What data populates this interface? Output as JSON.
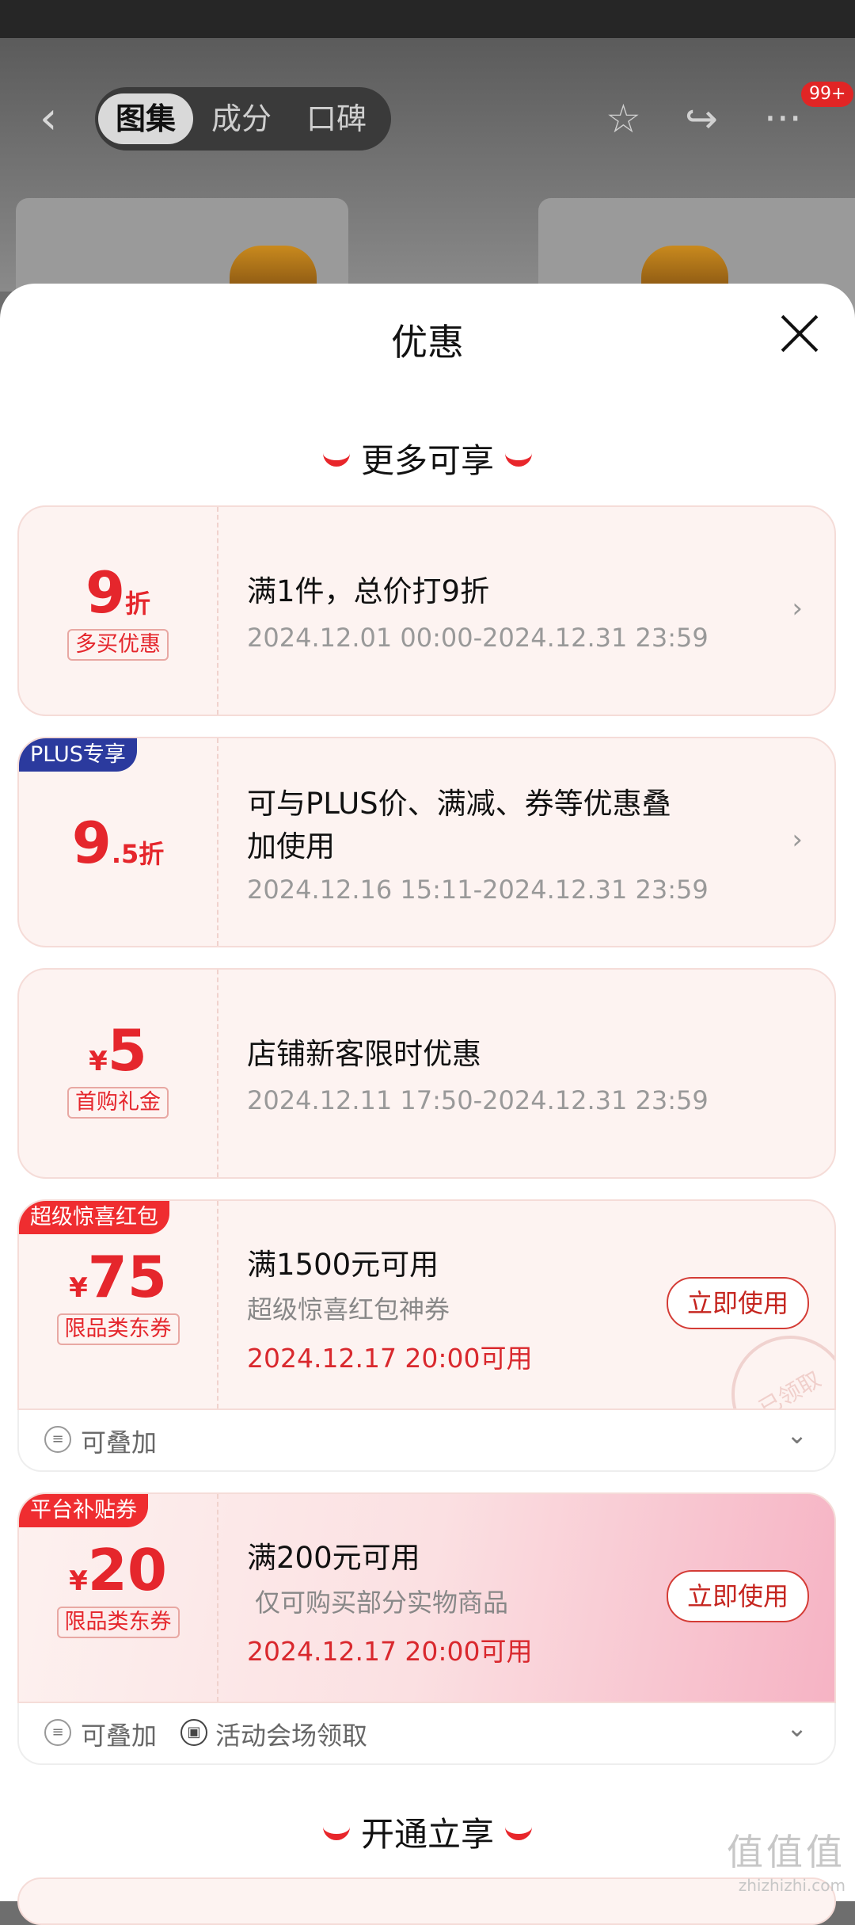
{
  "nav": {
    "back_icon": "‹",
    "tabs": [
      "图集",
      "成分",
      "口碑"
    ],
    "star_icon": "☆",
    "share_icon": "↪",
    "more_icon": "···",
    "badge": "99+"
  },
  "sheet": {
    "title": "优惠",
    "section1": "更多可享",
    "section2": "开通立享"
  },
  "offers": [
    {
      "num": "9",
      "unit": "折",
      "tag": "多买优惠",
      "title": "满1件，总价打9折",
      "date": "2024.12.01 00:00-2024.12.31 23:59"
    },
    {
      "corner": "PLUS专享",
      "num": "9",
      "unit": ".5折",
      "title_line1": "可与PLUS价、满减、券等优惠叠",
      "title_line2": "加使用",
      "date": "2024.12.16 15:11-2024.12.31 23:59"
    },
    {
      "yen": "¥",
      "num": "5",
      "tag": "首购礼金",
      "title": "店铺新客限时优惠",
      "date": "2024.12.11 17:50-2024.12.31 23:59"
    },
    {
      "corner": "超级惊喜红包",
      "yen": "¥",
      "num": "75",
      "tag": "限品类东券",
      "title": "满1500元可用",
      "sub": "超级惊喜红包神券",
      "date": "2024.12.17 20:00可用",
      "button": "立即使用",
      "stamp": "已领取",
      "footer": [
        "可叠加"
      ]
    },
    {
      "corner": "平台补贴券",
      "yen": "¥",
      "num": "20",
      "tag": "限品类东券",
      "title": "满200元可用",
      "sub": "仅可购买部分实物商品",
      "date": "2024.12.17 20:00可用",
      "button": "立即使用",
      "footer": [
        "可叠加",
        "活动会场领取"
      ]
    }
  ],
  "watermark": {
    "big": "值值值",
    "small": "zhizhizhi.com"
  },
  "colors": {
    "accent": "#e5262c",
    "plus": "#2b3a9e"
  }
}
